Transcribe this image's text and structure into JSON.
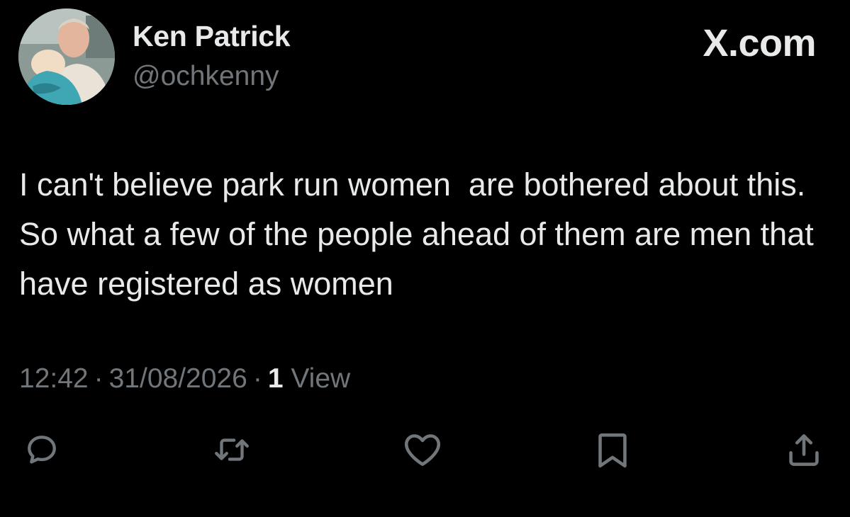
{
  "author": {
    "name": "Ken Patrick",
    "handle": "@ochkenny",
    "avatar_icon": "profile-photo"
  },
  "brand": "X.com",
  "tweet": {
    "text": "I can't believe park run women  are bothered about this. So what a few of the people ahead of them are men that have registered as women",
    "time": "12:42",
    "date": "31/08/2026",
    "separator": "·",
    "views_count": "1",
    "views_label": "View"
  },
  "actions": [
    {
      "icon": "reply-icon"
    },
    {
      "icon": "retweet-icon"
    },
    {
      "icon": "like-icon"
    },
    {
      "icon": "bookmark-icon"
    },
    {
      "icon": "share-icon"
    }
  ],
  "colors": {
    "background": "#000000",
    "primary_text": "#e7e9ea",
    "secondary_text": "#71767b",
    "icon": "#71767b"
  }
}
